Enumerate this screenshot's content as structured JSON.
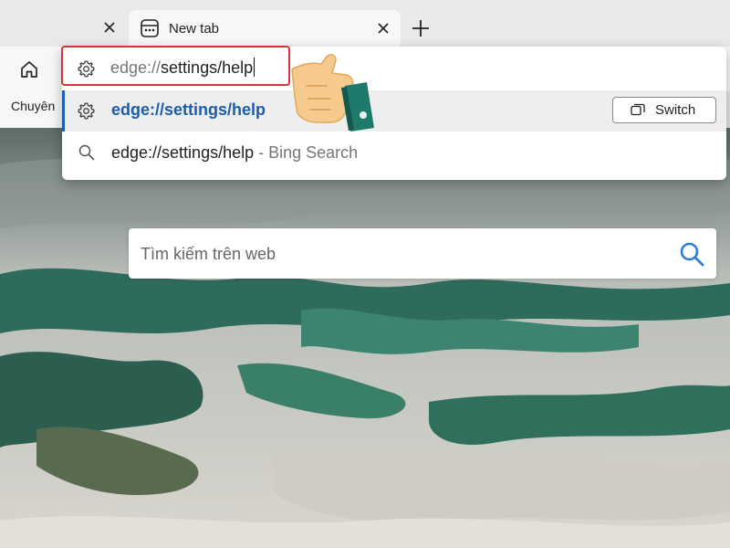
{
  "tabs": {
    "active_title": "New tab"
  },
  "favorites_bar": {
    "item_label": "Chuyên"
  },
  "address_bar": {
    "typed_prefix": "edge://",
    "typed_rest": "settings/help"
  },
  "suggestions": {
    "first": {
      "text": "edge://settings/help",
      "switch_label": "Switch"
    },
    "second": {
      "text": "edge://settings/help",
      "separator": " - ",
      "provider": "Bing Search"
    }
  },
  "new_tab_page": {
    "search_placeholder": "Tìm kiếm trên web"
  },
  "colors": {
    "highlight_border": "#d9323a",
    "link_blue": "#1c5ea8",
    "search_icon": "#2f7dd8"
  }
}
